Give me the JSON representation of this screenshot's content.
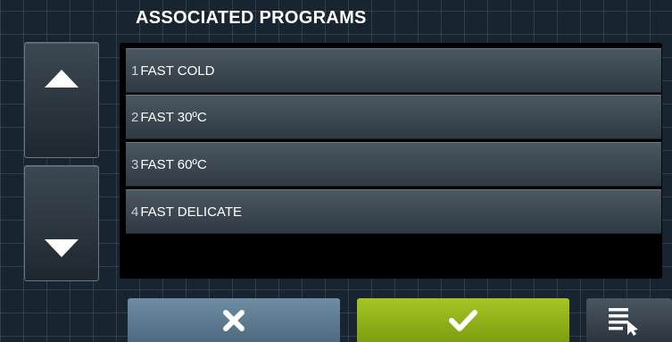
{
  "header": {
    "title": "ASSOCIATED PROGRAMS"
  },
  "programs": [
    {
      "number": "1",
      "name": "FAST COLD"
    },
    {
      "number": "2",
      "name": "FAST 30ºC"
    },
    {
      "number": "3",
      "name": "FAST 60ºC"
    },
    {
      "number": "4",
      "name": "FAST DELICATE"
    }
  ],
  "icons": {
    "scroll_up": "triangle-up-icon",
    "scroll_down": "triangle-down-icon",
    "cancel": "x-icon",
    "confirm": "checkmark-icon",
    "list_select": "list-select-icon"
  },
  "colors": {
    "cancel_button": "#5f7d92",
    "confirm_button": "#93b21a",
    "background": "#182430"
  }
}
